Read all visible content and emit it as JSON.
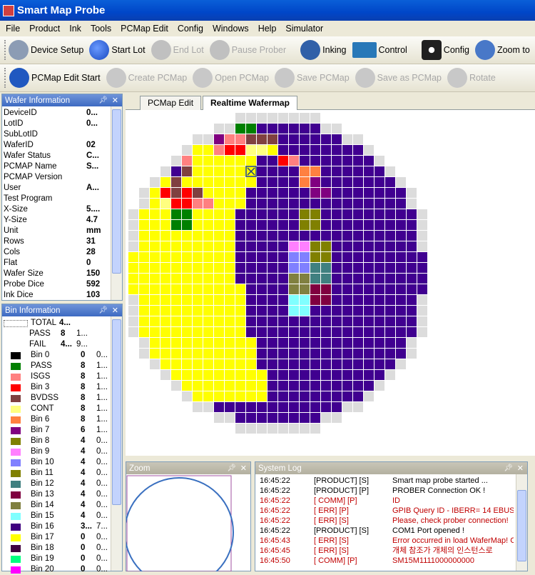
{
  "app": {
    "title": "Smart Map Probe"
  },
  "menu": [
    "File",
    "Product",
    "Ink",
    "Tools",
    "PCMap Edit",
    "Config",
    "Windows",
    "Help",
    "Simulator"
  ],
  "toolbar1": [
    {
      "label": "Device Setup",
      "icon": "database-icon",
      "enabled": true,
      "color": "#8c9cb4"
    },
    {
      "label": "Start Lot",
      "icon": "play-icon",
      "enabled": true,
      "color": "#1848c0"
    },
    {
      "label": "End Lot",
      "icon": "stop-icon",
      "enabled": false,
      "color": "#c0c0c0"
    },
    {
      "label": "Pause Prober",
      "icon": "pause-icon",
      "enabled": false,
      "color": "#c0c0c0"
    },
    {
      "label": "Inking",
      "icon": "ink-icon",
      "enabled": true,
      "color": "#3060a8"
    },
    {
      "label": "Control",
      "icon": "monitor-icon",
      "enabled": true,
      "color": "#2878b8"
    },
    {
      "label": "Config",
      "icon": "gear-icon",
      "enabled": true,
      "color": "#202020"
    },
    {
      "label": "Zoom to",
      "icon": "zoom-icon",
      "enabled": true,
      "color": "#4878c8"
    }
  ],
  "toolbar2": [
    {
      "label": "PCMap Edit Start",
      "icon": "globe-icon",
      "enabled": true,
      "color": "#2058c0"
    },
    {
      "label": "Create PCMap",
      "icon": "create-icon",
      "enabled": false,
      "color": "#c8c8c8"
    },
    {
      "label": "Open PCMap",
      "icon": "open-icon",
      "enabled": false,
      "color": "#c8c8c8"
    },
    {
      "label": "Save PCMap",
      "icon": "save-icon",
      "enabled": false,
      "color": "#c8c8c8"
    },
    {
      "label": "Save as PCMap",
      "icon": "save-as-icon",
      "enabled": false,
      "color": "#c8c8c8"
    },
    {
      "label": "Rotate",
      "icon": "rotate-icon",
      "enabled": false,
      "color": "#c8c8c8"
    }
  ],
  "wafer_info": {
    "title": "Wafer Information",
    "rows": [
      {
        "k": "DeviceID",
        "v": "0..."
      },
      {
        "k": "LotID",
        "v": "0..."
      },
      {
        "k": "SubLotID",
        "v": ""
      },
      {
        "k": "WaferID",
        "v": "02"
      },
      {
        "k": "Wafer Status",
        "v": "C..."
      },
      {
        "k": "PCMAP Name",
        "v": "S..."
      },
      {
        "k": "PCMAP Version",
        "v": ""
      },
      {
        "k": "User",
        "v": "A..."
      },
      {
        "k": "Test Program",
        "v": ""
      },
      {
        "k": "X-Size",
        "v": "5...."
      },
      {
        "k": "Y-Size",
        "v": "4.7"
      },
      {
        "k": "Unit",
        "v": "mm"
      },
      {
        "k": "Rows",
        "v": "31"
      },
      {
        "k": "Cols",
        "v": "28"
      },
      {
        "k": "Flat",
        "v": "0"
      },
      {
        "k": "Wafer Size",
        "v": "150"
      },
      {
        "k": "Probe Dice",
        "v": "592"
      },
      {
        "k": "Ink Dice",
        "v": "103"
      }
    ]
  },
  "bin_info": {
    "title": "Bin Information",
    "rows": [
      {
        "name": "TOTAL",
        "count": "4...",
        "pct": "",
        "color": ""
      },
      {
        "name": "PASS",
        "count": "8",
        "pct": "1...",
        "color": ""
      },
      {
        "name": "FAIL",
        "count": "4...",
        "pct": "9...",
        "color": ""
      },
      {
        "name": "Bin 0",
        "count": "0",
        "pct": "0...",
        "color": "#000000"
      },
      {
        "name": "PASS",
        "count": "8",
        "pct": "1...",
        "color": "#008000"
      },
      {
        "name": "ISGS",
        "count": "8",
        "pct": "1...",
        "color": "#ff8080"
      },
      {
        "name": "Bin 3",
        "count": "8",
        "pct": "1...",
        "color": "#ff0000"
      },
      {
        "name": "BVDSS",
        "count": "8",
        "pct": "1...",
        "color": "#804040"
      },
      {
        "name": "CONT",
        "count": "8",
        "pct": "1...",
        "color": "#ffff80"
      },
      {
        "name": "Bin 6",
        "count": "8",
        "pct": "1...",
        "color": "#ff8040"
      },
      {
        "name": "Bin 7",
        "count": "6",
        "pct": "1...",
        "color": "#800080"
      },
      {
        "name": "Bin 8",
        "count": "4",
        "pct": "0...",
        "color": "#808000"
      },
      {
        "name": "Bin 9",
        "count": "4",
        "pct": "0...",
        "color": "#ff80ff"
      },
      {
        "name": "Bin 10",
        "count": "4",
        "pct": "0...",
        "color": "#8080ff"
      },
      {
        "name": "Bin 11",
        "count": "4",
        "pct": "0...",
        "color": "#808000"
      },
      {
        "name": "Bin 12",
        "count": "4",
        "pct": "0...",
        "color": "#408080"
      },
      {
        "name": "Bin 13",
        "count": "4",
        "pct": "0...",
        "color": "#800040"
      },
      {
        "name": "Bin 14",
        "count": "4",
        "pct": "0...",
        "color": "#808040"
      },
      {
        "name": "Bin 15",
        "count": "4",
        "pct": "0...",
        "color": "#80ffff"
      },
      {
        "name": "Bin 16",
        "count": "3...",
        "pct": "7...",
        "color": "#400080"
      },
      {
        "name": "Bin 17",
        "count": "0",
        "pct": "0...",
        "color": "#ffff00"
      },
      {
        "name": "Bin 18",
        "count": "0",
        "pct": "0...",
        "color": "#400040"
      },
      {
        "name": "Bin 19",
        "count": "0",
        "pct": "0...",
        "color": "#00ff80"
      },
      {
        "name": "Bin 20",
        "count": "0",
        "pct": "0...",
        "color": "#ff00ff"
      }
    ]
  },
  "tabs": [
    {
      "label": "PCMap Edit",
      "active": false
    },
    {
      "label": "Realtime Wafermap",
      "active": true
    }
  ],
  "zoom_panel": {
    "title": "Zoom"
  },
  "log_panel": {
    "title": "System Log",
    "rows": [
      {
        "time": "16:45:22",
        "src": "[PRODUCT] [S]",
        "msg": "Smart map probe started ...",
        "color": "#000000"
      },
      {
        "time": "16:45:22",
        "src": "[PRODUCT] [P]",
        "msg": "PROBER Connection  OK !",
        "color": "#000000"
      },
      {
        "time": "16:45:22",
        "src": "[    COMM] [P]",
        "msg": "ID",
        "color": "#c00000"
      },
      {
        "time": "16:45:22",
        "src": "[      ERR] [P]",
        "msg": "GPIB Query ID - IBERR= 14  EBUS",
        "color": "#c00000"
      },
      {
        "time": "16:45:22",
        "src": "[      ERR] [S]",
        "msg": "Please, check prober connection!",
        "color": "#c00000"
      },
      {
        "time": "16:45:22",
        "src": "[PRODUCT] [S]",
        "msg": "COM1 Port opened !",
        "color": "#000000"
      },
      {
        "time": "16:45:43",
        "src": "[      ERR] [S]",
        "msg": "Error occurred in load WaferMap! C",
        "color": "#c00000"
      },
      {
        "time": "16:45:45",
        "src": "[      ERR] [S]",
        "msg": "개체 참조가 개체의 인스턴스로",
        "color": "#c00000"
      },
      {
        "time": "16:45:50",
        "src": "[    COMM] [P]",
        "msg": "SM15M1111000000000",
        "color": "#c00000"
      }
    ]
  },
  "wafermap": {
    "rows": 31,
    "cols": 28,
    "colors": {
      "pass": "#ffff00",
      "fail": "#400090",
      "untested": "#dcdcdc",
      "b2": "#ff8080",
      "b3": "#ff0000",
      "b4": "#804040",
      "b5": "#ffff80",
      "b6": "#ff8040",
      "b7": "#800080",
      "b8": "#808000",
      "b9": "#ff80ff",
      "b10": "#8080ff",
      "b12": "#408080",
      "b13": "#800040",
      "b14": "#808040",
      "b15": "#80ffff",
      "b1": "#008000"
    }
  }
}
